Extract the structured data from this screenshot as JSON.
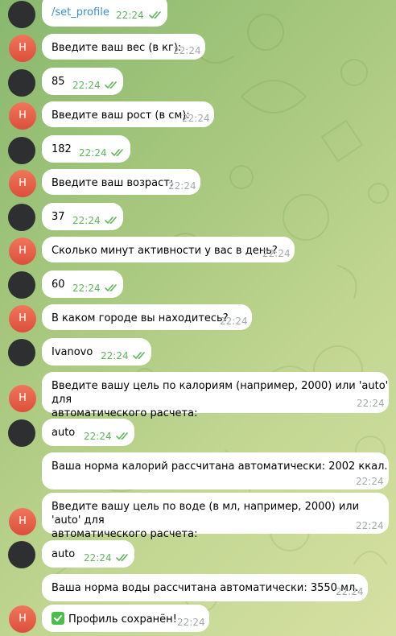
{
  "bot_avatar_letter": "Н",
  "colors": {
    "bot_avatar": "#e4574a",
    "read_checks": "#5fb55a",
    "link": "#3a8ed6",
    "time_gray": "#a3a8ad"
  },
  "messages": [
    {
      "sender": "user",
      "text": "/set_profile",
      "time": "22:24",
      "is_command": true
    },
    {
      "sender": "bot",
      "text": "Введите ваш вес (в кг):",
      "time": "22:24"
    },
    {
      "sender": "user",
      "text": "85",
      "time": "22:24"
    },
    {
      "sender": "bot",
      "text": "Введите ваш рост (в см):",
      "time": "22:24"
    },
    {
      "sender": "user",
      "text": "182",
      "time": "22:24"
    },
    {
      "sender": "bot",
      "text": "Введите ваш возраст:",
      "time": "22:24"
    },
    {
      "sender": "user",
      "text": "37",
      "time": "22:24"
    },
    {
      "sender": "bot",
      "text": "Сколько минут активности у вас в день?",
      "time": "22:24"
    },
    {
      "sender": "user",
      "text": "60",
      "time": "22:24"
    },
    {
      "sender": "bot",
      "text": "В каком городе вы находитесь?",
      "time": "22:24"
    },
    {
      "sender": "user",
      "text": "Ivanovo",
      "time": "22:24"
    },
    {
      "sender": "bot",
      "lines": [
        "Введите вашу цель по калориям (например, 2000) или 'auto' для",
        "автоматического расчета:"
      ],
      "time": "22:24"
    },
    {
      "sender": "user",
      "text": "auto",
      "time": "22:24"
    },
    {
      "sender": "bot",
      "text": "Ваша норма калорий рассчитана автоматически: 2002 ккал.",
      "time": "22:24"
    },
    {
      "sender": "bot",
      "lines": [
        "Введите вашу цель по воде (в мл, например, 2000) или 'auto' для",
        "автоматического расчета:"
      ],
      "time": "22:24"
    },
    {
      "sender": "user",
      "text": "auto",
      "time": "22:24"
    },
    {
      "sender": "bot",
      "text": "Ваша норма воды рассчитана автоматически: 3550 мл.",
      "time": "22:24"
    },
    {
      "sender": "bot",
      "text": "Профиль сохранён!",
      "time": "22:24",
      "emoji": "check-mark-button"
    }
  ]
}
